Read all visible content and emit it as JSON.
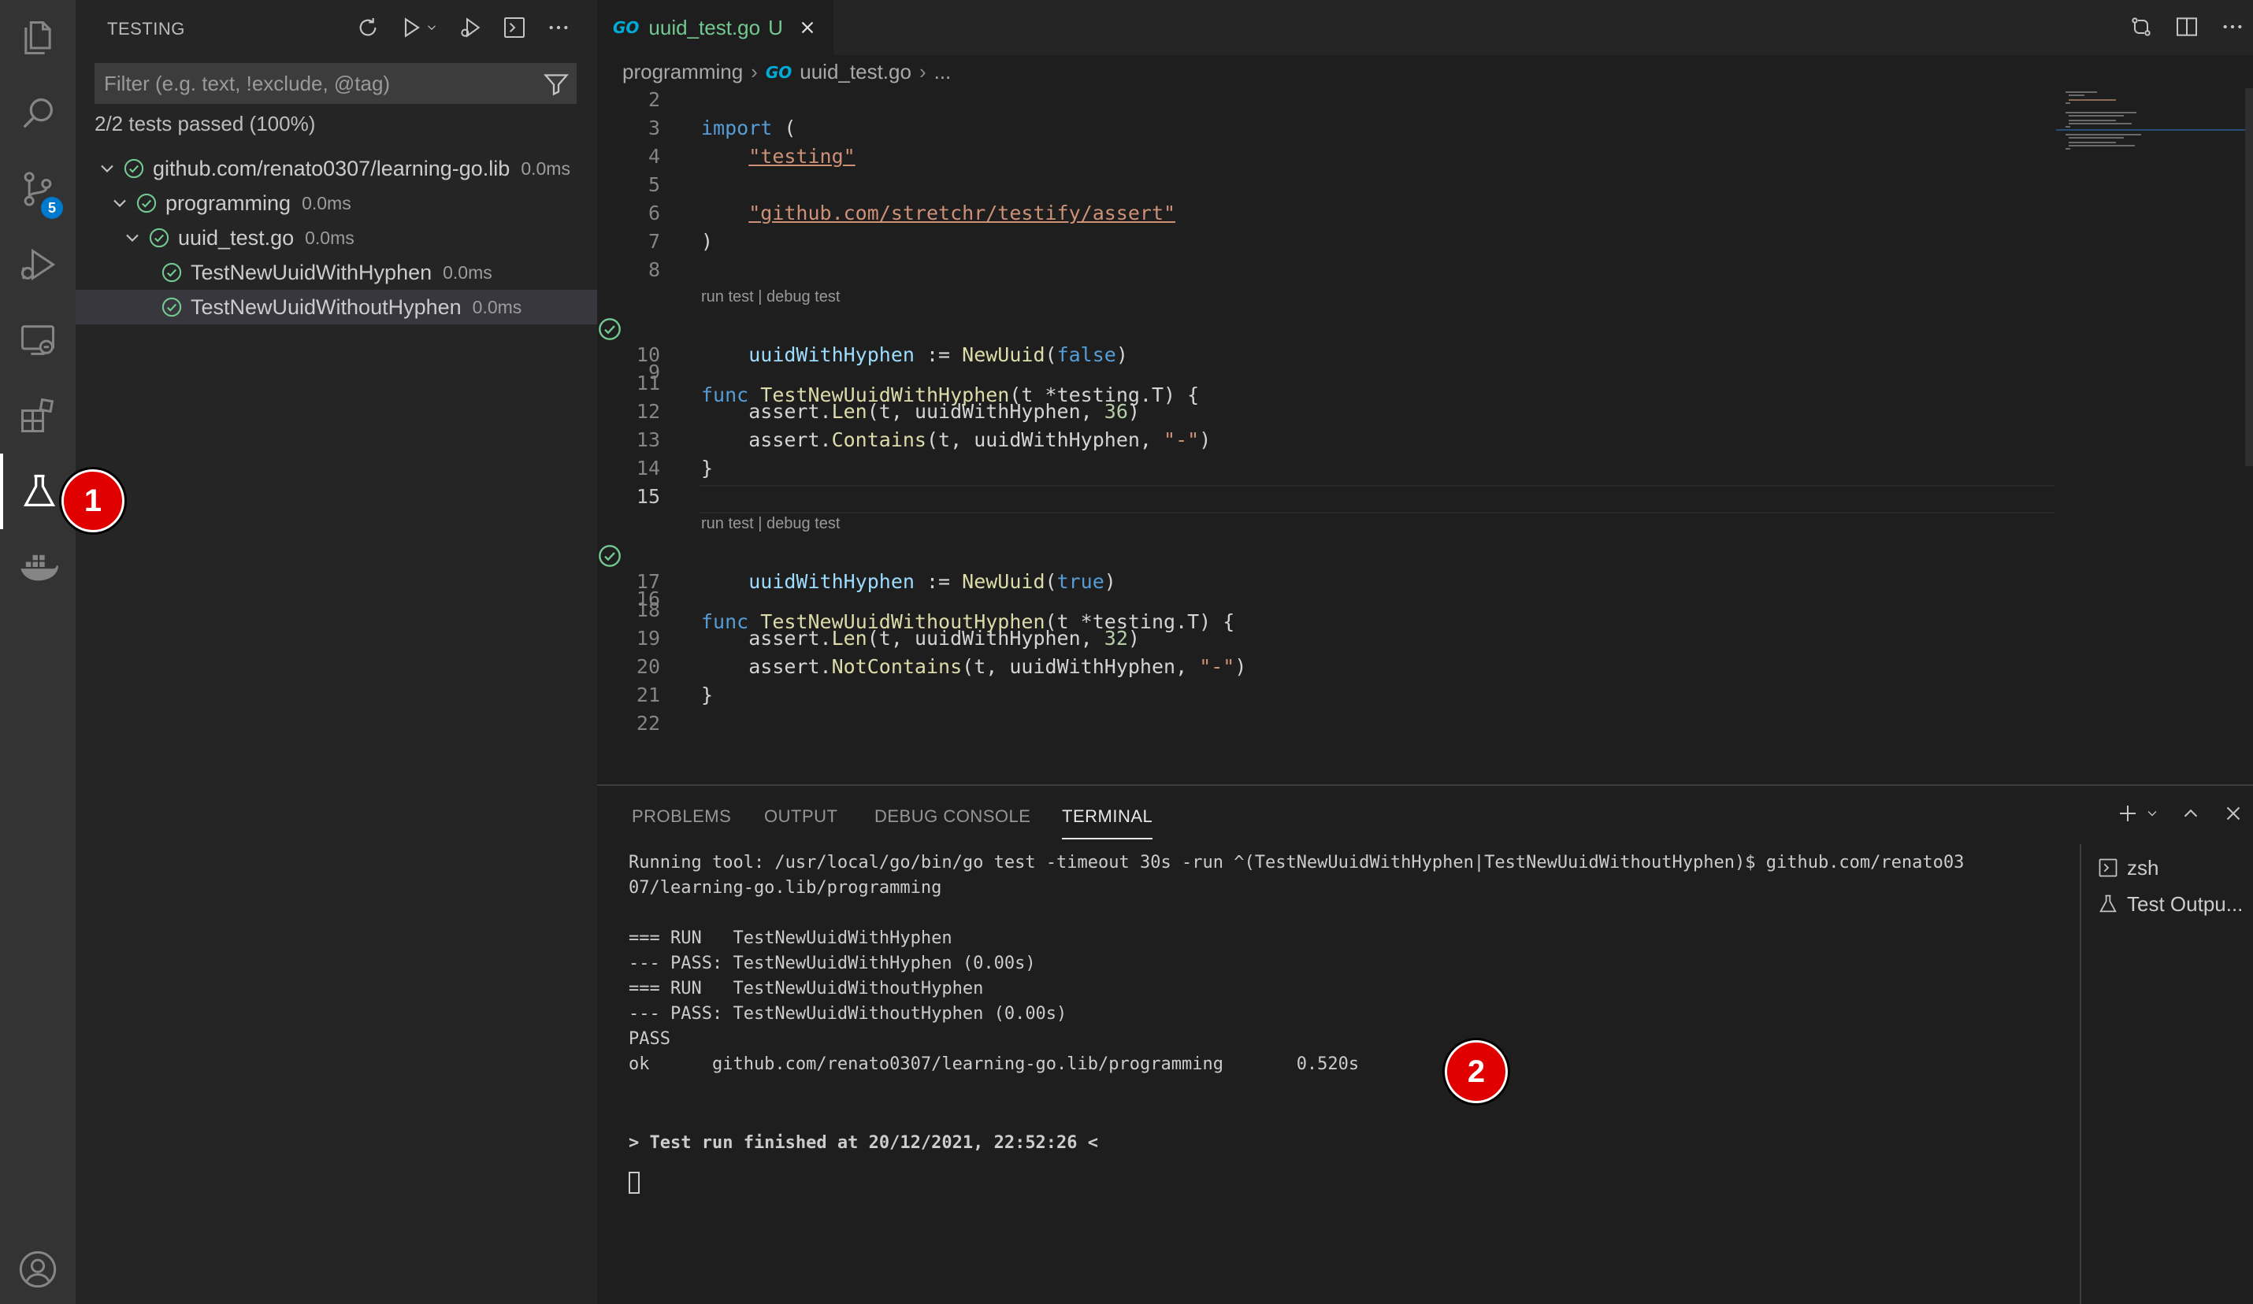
{
  "activity_bar": {
    "source_control_badge": "5"
  },
  "sidebar": {
    "title": "TESTING",
    "filter_placeholder": "Filter (e.g. text, !exclude, @tag)",
    "summary": "2/2 tests passed (100%)",
    "tree": [
      {
        "label": "github.com/renato0307/learning-go.lib",
        "duration": "0.0ms"
      },
      {
        "label": "programming",
        "duration": "0.0ms"
      },
      {
        "label": "uuid_test.go",
        "duration": "0.0ms"
      },
      {
        "label": "TestNewUuidWithHyphen",
        "duration": "0.0ms"
      },
      {
        "label": "TestNewUuidWithoutHyphen",
        "duration": "0.0ms"
      }
    ]
  },
  "editor": {
    "tab": {
      "icon": "GO",
      "filename": "uuid_test.go",
      "status": "U"
    },
    "breadcrumb": {
      "folder": "programming",
      "file": "uuid_test.go",
      "more": "..."
    },
    "codelens": "run test | debug test",
    "line_numbers": [
      "2",
      "3",
      "4",
      "5",
      "6",
      "7",
      "8",
      "9",
      "10",
      "11",
      "12",
      "13",
      "14",
      "15",
      "16",
      "17",
      "18",
      "19",
      "20",
      "21",
      "22"
    ],
    "code": {
      "import_kw": "import",
      "import_open": " (",
      "pkg_testing": "\"testing\"",
      "pkg_assert": "\"github.com/stretchr/testify/assert\"",
      "close_paren": ")",
      "func_kw": "func",
      "fn1_name": "TestNewUuidWithHyphen",
      "fn2_name": "TestNewUuidWithoutHyphen",
      "params": "(t *testing.T) {",
      "var_name": "uuidWithHyphen",
      "assign": " := ",
      "ctor": "NewUuid",
      "false_lit": "false",
      "true_lit": "true",
      "assert_prefix": "assert.",
      "len_fn": "Len",
      "contains_fn": "Contains",
      "notcontains_fn": "NotContains",
      "len_args_pre": "(t, uuidWithHyphen, ",
      "num36": "36",
      "num32": "32",
      "contains_args_pre": "(t, uuidWithHyphen, ",
      "dash_str": "\"-\"",
      "close_brace": "}"
    }
  },
  "panel": {
    "tabs": [
      "PROBLEMS",
      "OUTPUT",
      "DEBUG CONSOLE",
      "TERMINAL"
    ],
    "terminal_lines": [
      "Running tool: /usr/local/go/bin/go test -timeout 30s -run ^(TestNewUuidWithHyphen|TestNewUuidWithoutHyphen)$ github.com/renato03",
      "07/learning-go.lib/programming",
      "",
      "=== RUN   TestNewUuidWithHyphen",
      "--- PASS: TestNewUuidWithHyphen (0.00s)",
      "=== RUN   TestNewUuidWithoutHyphen",
      "--- PASS: TestNewUuidWithoutHyphen (0.00s)",
      "PASS",
      "ok      github.com/renato0307/learning-go.lib/programming       0.520s"
    ],
    "finished_line": "> Test run finished at 20/12/2021, 22:52:26 <",
    "terminals": [
      "zsh",
      "Test Outpu..."
    ]
  },
  "callouts": [
    "1",
    "2"
  ],
  "colors": {
    "accent_blue": "#007acc",
    "pass_green": "#73c991",
    "callout_red": "#e00000"
  }
}
